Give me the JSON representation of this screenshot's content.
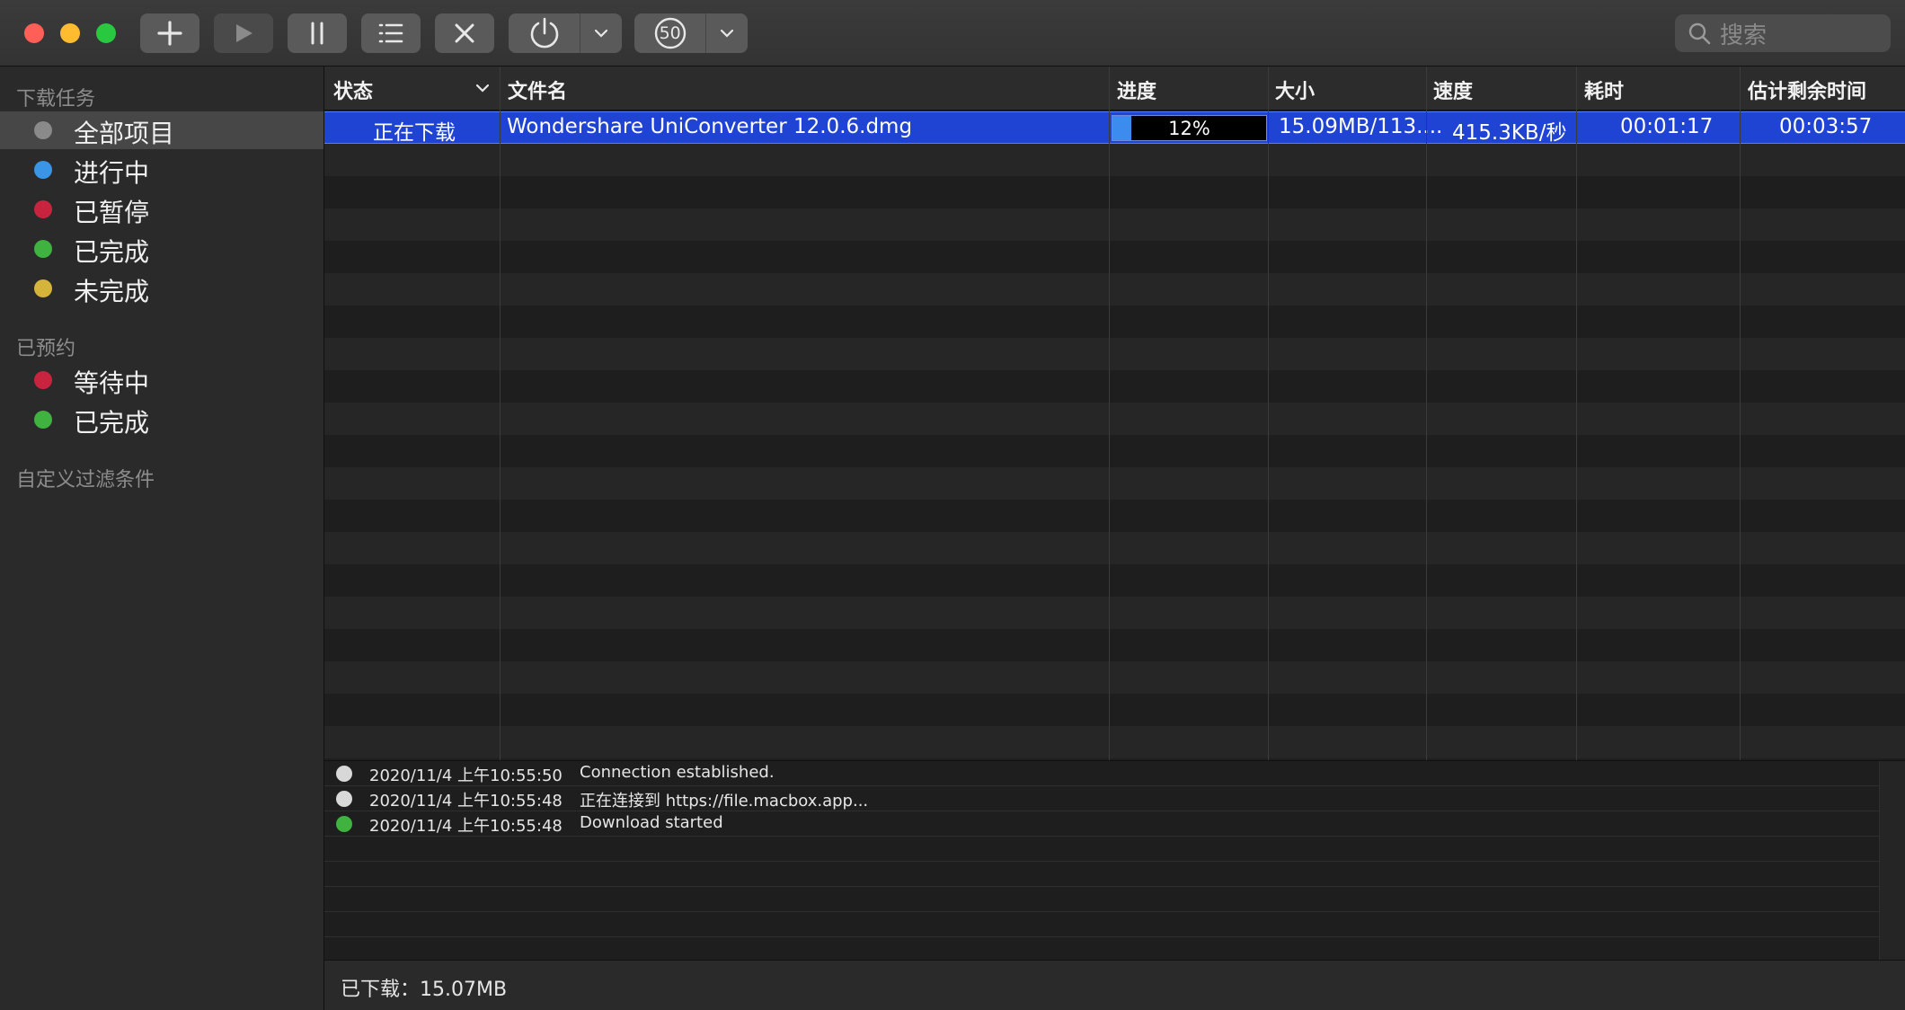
{
  "colors": {
    "traffic_close": "#ff5f57",
    "traffic_minimize": "#febc2e",
    "traffic_zoom": "#28c840",
    "selection": "#1f43d3",
    "progress_fill": "#3c8cf0"
  },
  "toolbar": {
    "buttons": [
      {
        "icon": "plus-icon"
      },
      {
        "icon": "play-icon"
      },
      {
        "icon": "pause-icon"
      },
      {
        "icon": "list-icon"
      },
      {
        "icon": "close-x-icon"
      },
      {
        "icon": "power-icon"
      },
      {
        "icon": "chevron-down-icon"
      },
      {
        "icon": "speed-limit-icon"
      },
      {
        "icon": "chevron-down-icon"
      }
    ],
    "speed_limit_value": "50",
    "search_placeholder": "搜索"
  },
  "sidebar": {
    "section_downloads": "下载任务",
    "download_items": [
      {
        "label": "全部项目",
        "dot": "#8a8a8a",
        "selected": true
      },
      {
        "label": "进行中",
        "dot": "#3a95e6"
      },
      {
        "label": "已暂停",
        "dot": "#c8243f"
      },
      {
        "label": "已完成",
        "dot": "#3fb240"
      },
      {
        "label": "未完成",
        "dot": "#d4b43a"
      }
    ],
    "section_scheduled": "已预约",
    "scheduled_items": [
      {
        "label": "等待中",
        "dot": "#c8243f"
      },
      {
        "label": "已完成",
        "dot": "#3fb240"
      }
    ],
    "section_custom": "自定义过滤条件"
  },
  "table": {
    "columns": [
      "状态",
      "文件名",
      "进度",
      "大小",
      "速度",
      "耗时",
      "估计剩余时间"
    ],
    "rows": [
      {
        "status": "正在下载",
        "filename": "Wondershare UniConverter 12.0.6.dmg",
        "progress_label": "12%",
        "progress_fraction": 0.12,
        "size": "15.09MB/113....",
        "speed": "415.3KB/秒",
        "elapsed": "00:01:17",
        "remaining": "00:03:57"
      }
    ]
  },
  "log": {
    "entries": [
      {
        "time": "2020/11/4 上午10:55:50",
        "message": "Connection established.",
        "dot": "#d8d8d8"
      },
      {
        "time": "2020/11/4 上午10:55:48",
        "message": "正在连接到 https://file.macbox.app...",
        "dot": "#d8d8d8"
      },
      {
        "time": "2020/11/4 上午10:55:48",
        "message": "Download started",
        "dot": "#3fb240"
      }
    ]
  },
  "statusbar": {
    "downloaded": "已下载：15.07MB"
  }
}
